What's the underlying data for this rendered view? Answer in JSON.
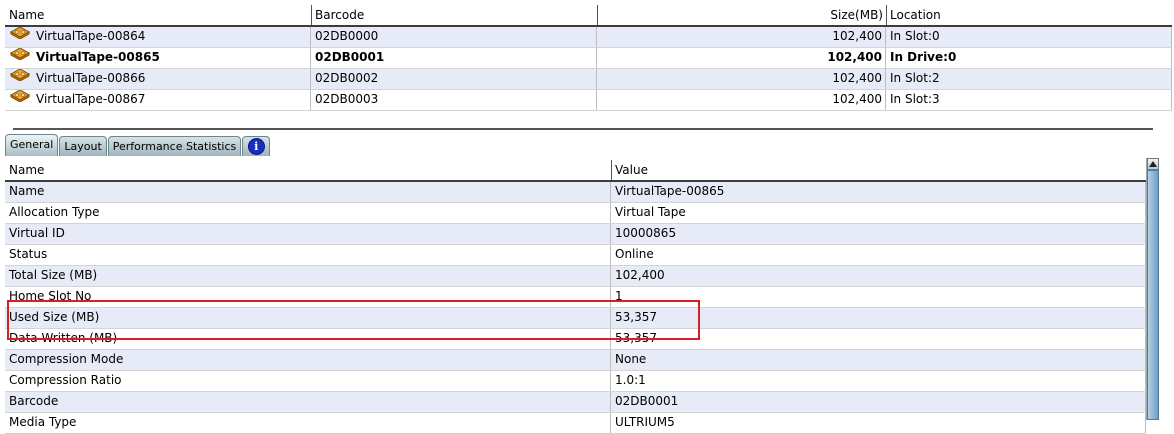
{
  "tapes_table": {
    "columns": {
      "name": "Name",
      "barcode": "Barcode",
      "size": "Size(MB)",
      "location": "Location"
    },
    "rows": [
      {
        "name": "VirtualTape-00864",
        "barcode": "02DB0000",
        "size": "102,400",
        "location": "In Slot:0",
        "selected": false
      },
      {
        "name": "VirtualTape-00865",
        "barcode": "02DB0001",
        "size": "102,400",
        "location": "In Drive:0",
        "selected": true
      },
      {
        "name": "VirtualTape-00866",
        "barcode": "02DB0002",
        "size": "102,400",
        "location": "In Slot:2",
        "selected": false
      },
      {
        "name": "VirtualTape-00867",
        "barcode": "02DB0003",
        "size": "102,400",
        "location": "In Slot:3",
        "selected": false
      }
    ]
  },
  "tabs": [
    {
      "label": "General",
      "active": true
    },
    {
      "label": "Layout",
      "active": false
    },
    {
      "label": "Performance Statistics",
      "active": false
    }
  ],
  "info_tab_glyph": "i",
  "properties_table": {
    "columns": {
      "name": "Name",
      "value": "Value"
    },
    "rows": [
      {
        "name": "Name",
        "value": "VirtualTape-00865"
      },
      {
        "name": "Allocation Type",
        "value": "Virtual Tape"
      },
      {
        "name": "Virtual ID",
        "value": "10000865"
      },
      {
        "name": "Status",
        "value": "Online"
      },
      {
        "name": "Total Size (MB)",
        "value": "102,400"
      },
      {
        "name": "Home Slot No",
        "value": "1"
      },
      {
        "name": "Used Size (MB)",
        "value": "53,357"
      },
      {
        "name": "Data Written (MB)",
        "value": "53,357"
      },
      {
        "name": "Compression Mode",
        "value": "None"
      },
      {
        "name": "Compression Ratio",
        "value": "1.0:1"
      },
      {
        "name": "Barcode",
        "value": "02DB0001"
      },
      {
        "name": "Media Type",
        "value": "ULTRIUM5"
      }
    ]
  },
  "icons": {
    "tape": "tape-cartridge-icon",
    "info": "info-icon",
    "scroll_up": "scroll-up-arrow-icon"
  },
  "colors": {
    "row_alt": "#e7ebf7",
    "highlight": "#d81f26",
    "tape_orange": "#f0a020"
  }
}
